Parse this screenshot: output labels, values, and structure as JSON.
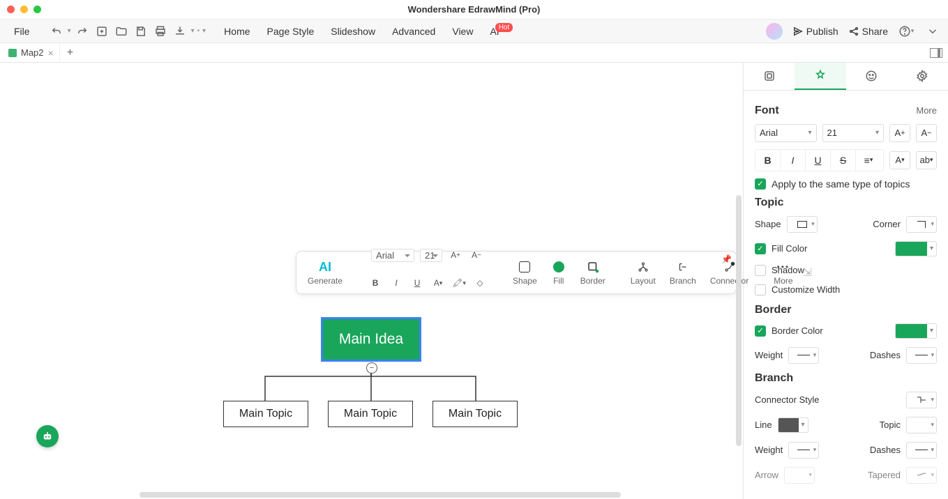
{
  "titlebar": {
    "title": "Wondershare EdrawMind (Pro)"
  },
  "menu": {
    "file": "File",
    "home": "Home",
    "page_style": "Page Style",
    "slideshow": "Slideshow",
    "advanced": "Advanced",
    "view": "View",
    "ai": "AI",
    "ai_badge": "Hot",
    "publish": "Publish",
    "share": "Share"
  },
  "tabs": {
    "active": "Map2"
  },
  "float": {
    "ai": "AI",
    "generate": "Generate",
    "font": "Arial",
    "size": "21",
    "shape": "Shape",
    "fill": "Fill",
    "border": "Border",
    "layout": "Layout",
    "branch": "Branch",
    "connector": "Connector",
    "more": "More"
  },
  "mindmap": {
    "main": "Main Idea",
    "sub1": "Main Topic",
    "sub2": "Main Topic",
    "sub3": "Main Topic"
  },
  "panel": {
    "font": {
      "title": "Font",
      "more": "More",
      "family": "Arial",
      "size": "21",
      "apply_same": "Apply to the same type of topics"
    },
    "topic": {
      "title": "Topic",
      "shape": "Shape",
      "corner": "Corner",
      "fill_color": "Fill Color",
      "shadow": "Shadow",
      "custom_width": "Customize Width"
    },
    "border": {
      "title": "Border",
      "border_color": "Border Color",
      "weight": "Weight",
      "dashes": "Dashes"
    },
    "branch": {
      "title": "Branch",
      "connector_style": "Connector Style",
      "line": "Line",
      "topic": "Topic",
      "weight": "Weight",
      "dashes": "Dashes",
      "arrow": "Arrow",
      "tapered": "Tapered"
    }
  }
}
